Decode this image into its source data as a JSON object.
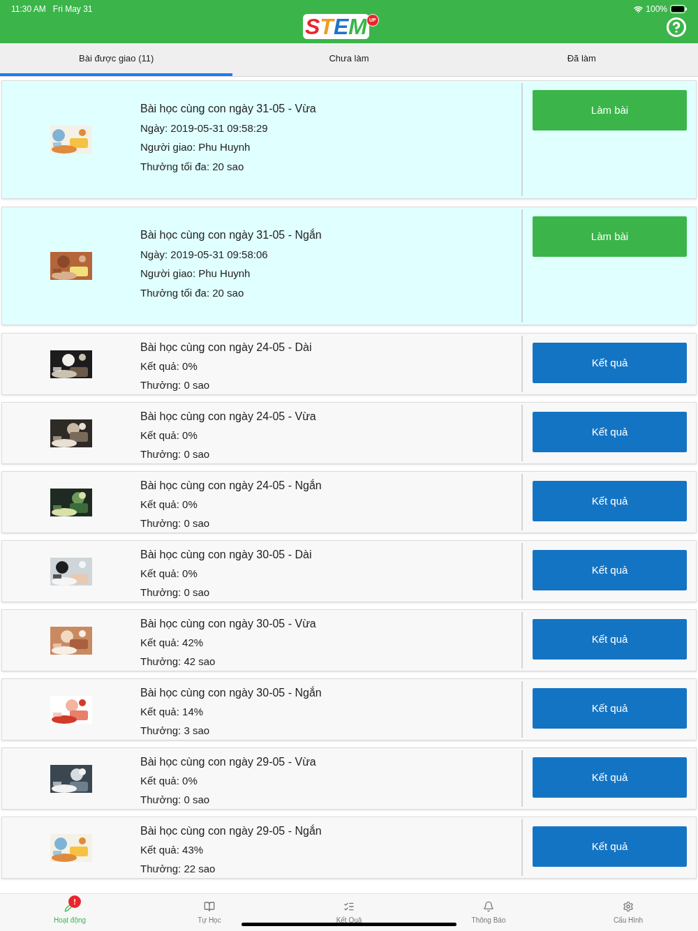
{
  "status_bar": {
    "time": "11:30 AM",
    "date": "Fri May 31",
    "battery": "100%"
  },
  "header": {
    "logo_letters": [
      {
        "text": "S",
        "color": "#e8262d"
      },
      {
        "text": "T",
        "color": "#f39a1e"
      },
      {
        "text": "E",
        "color": "#1e73c8"
      },
      {
        "text": "M",
        "color": "#3bb54a"
      }
    ],
    "logo_badge": "UP"
  },
  "tabs": [
    {
      "label": "Bài được giao (11)",
      "selected": true
    },
    {
      "label": "Chưa làm",
      "selected": false
    },
    {
      "label": "Đã làm",
      "selected": false
    }
  ],
  "assignments": [
    {
      "kind": "pending",
      "title": "Bài học cùng con ngày 31-05 - Vừa",
      "lines": [
        "Ngày: 2019-05-31 09:58:29",
        "Người giao: Phu Huynh",
        "Thưởng tối đa: 20 sao"
      ],
      "button": "Làm bài"
    },
    {
      "kind": "pending",
      "title": "Bài học cùng con ngày 31-05 - Ngắn",
      "lines": [
        "Ngày: 2019-05-31 09:58:06",
        "Người giao: Phu Huynh",
        "Thưởng tối đa: 20 sao"
      ],
      "button": "Làm bài"
    },
    {
      "kind": "done",
      "title": "Bài học cùng con ngày 24-05 - Dài",
      "lines": [
        "Kết quả: 0%",
        "Thưởng: 0 sao"
      ],
      "button": "Kết quả"
    },
    {
      "kind": "done",
      "title": "Bài học cùng con ngày 24-05 - Vừa",
      "lines": [
        "Kết quả: 0%",
        "Thưởng: 0 sao"
      ],
      "button": "Kết quả"
    },
    {
      "kind": "done",
      "title": "Bài học cùng con ngày 24-05 - Ngắn",
      "lines": [
        "Kết quả: 0%",
        "Thưởng: 0 sao"
      ],
      "button": "Kết quả"
    },
    {
      "kind": "done",
      "title": "Bài học cùng con ngày 30-05 - Dài",
      "lines": [
        "Kết quả: 0%",
        "Thưởng: 0 sao"
      ],
      "button": "Kết quả"
    },
    {
      "kind": "done",
      "title": "Bài học cùng con ngày 30-05 - Vừa",
      "lines": [
        "Kết quả: 42%",
        "Thưởng: 42 sao"
      ],
      "button": "Kết quả"
    },
    {
      "kind": "done",
      "title": "Bài học cùng con ngày 30-05 - Ngắn",
      "lines": [
        "Kết quả: 14%",
        "Thưởng: 3 sao"
      ],
      "button": "Kết quả"
    },
    {
      "kind": "done",
      "title": "Bài học cùng con ngày 29-05 - Vừa",
      "lines": [
        "Kết quả: 0%",
        "Thưởng: 0 sao"
      ],
      "button": "Kết quả"
    },
    {
      "kind": "done",
      "title": "Bài học cùng con ngày 29-05 - Ngắn",
      "lines": [
        "Kết quả: 43%",
        "Thưởng: 22 sao"
      ],
      "button": "Kết quả"
    }
  ],
  "bottom_tabs": [
    {
      "label": "Hoạt động",
      "selected": true,
      "badge": "!"
    },
    {
      "label": "Tự Học",
      "selected": false
    },
    {
      "label": "Kết Quả",
      "selected": false
    },
    {
      "label": "Thông Báo",
      "selected": false
    },
    {
      "label": "Cấu Hình",
      "selected": false
    }
  ]
}
